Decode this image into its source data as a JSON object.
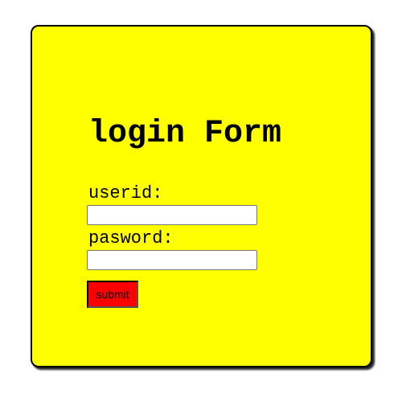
{
  "login_form": {
    "title": "login Form",
    "userid_label": "userid:",
    "userid_value": "",
    "password_label": "pasword:",
    "password_value": "",
    "submit_label": "submit"
  },
  "colors": {
    "card_background": "#ffff00",
    "card_border": "#000000",
    "submit_background": "#ff0000",
    "page_background": "#ffffff"
  }
}
